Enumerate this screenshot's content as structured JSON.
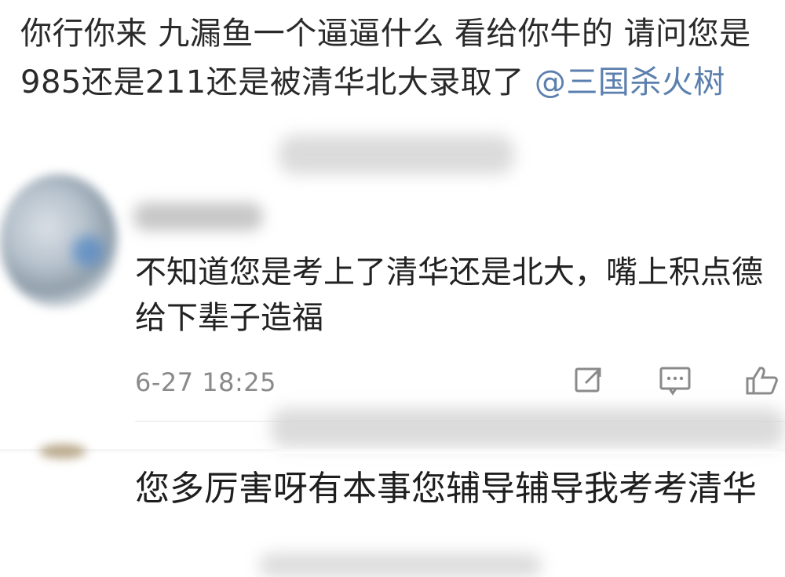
{
  "top_comment": {
    "text": "你行你来 九漏鱼一个逼逼什么 看给你牛的 请问您是985还是211还是被清华北大录取了",
    "mention": "@三国杀火树"
  },
  "reply": {
    "text": "不知道您是考上了清华还是北大，嘴上积点德给下辈子造福",
    "timestamp": "6-27 18:25",
    "icons": [
      "share-icon",
      "comment-icon",
      "like-icon"
    ]
  },
  "second_reply": {
    "text": "您多厉害呀有本事您辅导辅导我考考清华"
  },
  "colors": {
    "mention": "#5b7fae",
    "timestamp": "#8a8a8a",
    "icon": "#8a8a8a"
  }
}
